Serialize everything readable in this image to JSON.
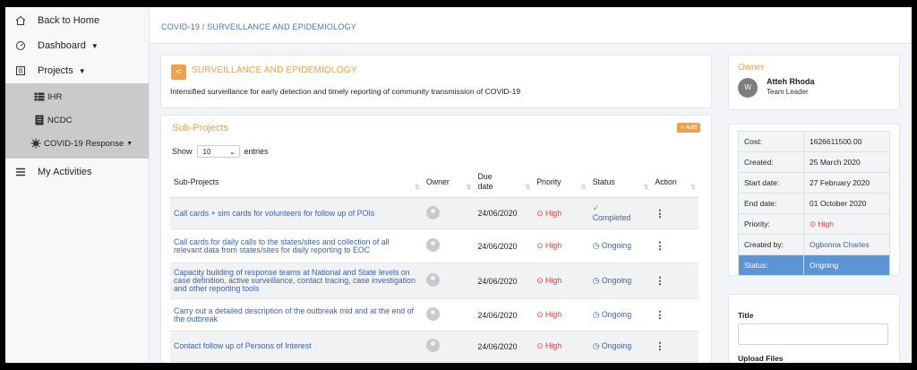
{
  "sidebar": {
    "back": "Back to Home",
    "dashboard": "Dashboard",
    "projects": "Projects",
    "sub_items": [
      {
        "label": "IHR",
        "icon": "table-icon"
      },
      {
        "label": "NCDC",
        "icon": "building-icon"
      },
      {
        "label": "COVID-19 Response",
        "icon": "virus-icon"
      }
    ],
    "activities": "My Activities"
  },
  "breadcrumb": {
    "parent": "COVID-19",
    "separator": " / ",
    "current": "SURVEILLANCE AND EPIDEMIOLOGY"
  },
  "project": {
    "back_icon": "<",
    "title": "SURVEILLANCE AND EPIDEMIOLOGY",
    "description": "Intensified surveillance for early detection and timely reporting of community transmission of COVID-19"
  },
  "subprojects": {
    "title": "Sub-Projects",
    "add_label": "+ Add",
    "show_label": "Show",
    "page_size": "10",
    "entries_label": "entries",
    "columns": [
      "Sub-Projects",
      "Owner",
      "Due date",
      "Priority",
      "Status",
      "Action"
    ],
    "rows": [
      {
        "name": "Call cards + sim cards for volunteers for follow up of POIs",
        "due": "24/06/2020",
        "priority": "High",
        "status": "Completed",
        "status_icon": "✓",
        "action": "⋮"
      },
      {
        "name": "Call cards for daily calls to the states/sites and collection of all relevant data from states/sites for daily reporting to EOC",
        "due": "24/06/2020",
        "priority": "High",
        "status": "Ongoing",
        "status_icon": "◷",
        "action": "⋮"
      },
      {
        "name": "Capacity building of response teams at National and State levels on case definition, active surveillance, contact tracing, case investigation and other reporting tools",
        "due": "24/06/2020",
        "priority": "High",
        "status": "Ongoing",
        "status_icon": "◷",
        "action": "⋮"
      },
      {
        "name": "Carry out a detailed description of the outbreak mid and at the end of the outbreak",
        "due": "24/06/2020",
        "priority": "High",
        "status": "Ongoing",
        "status_icon": "◷",
        "action": "⋮"
      },
      {
        "name": "Contact follow up of Persons of Interest",
        "due": "24/06/2020",
        "priority": "High",
        "status": "Ongoing",
        "status_icon": "◷",
        "action": "⋮"
      }
    ]
  },
  "owner": {
    "label": "Owner",
    "initial": "W",
    "name": "Atteh Rhoda",
    "role": "Team Leader"
  },
  "details": [
    {
      "label": "Cost:",
      "value": "1626611500.00"
    },
    {
      "label": "Created:",
      "value": "25 March 2020"
    },
    {
      "label": "Start date:",
      "value": "27 February 2020"
    },
    {
      "label": "End date:",
      "value": "01 October 2020"
    },
    {
      "label": "Priority:",
      "value": "High"
    },
    {
      "label": "Created by:",
      "value": "Ogbonna Charles"
    },
    {
      "label": "Status:",
      "value": "Ongoing"
    }
  ],
  "upload": {
    "title_label": "Title",
    "files_label": "Upload Files"
  },
  "colors": {
    "accent": "#f0a04b",
    "link": "#3b62b0",
    "priority_high": "#d93d3d",
    "status_active_row": "#5b95d6"
  }
}
